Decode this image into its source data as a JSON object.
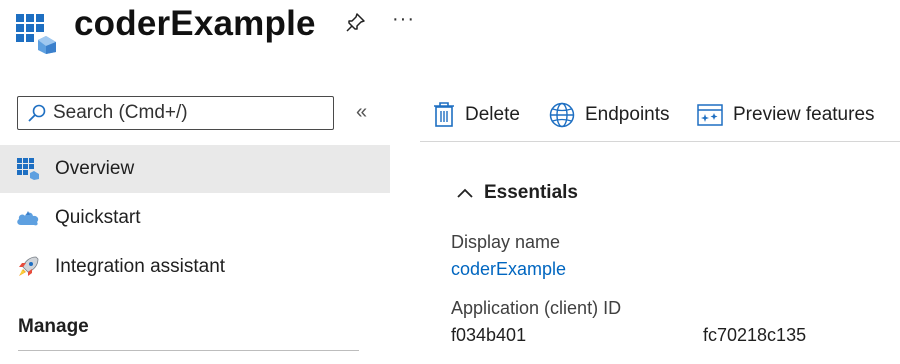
{
  "header": {
    "title": "coderExample",
    "pin_icon": "pin-icon",
    "more_label": "···"
  },
  "sidebar": {
    "search": {
      "placeholder": "Search (Cmd+/)",
      "value": ""
    },
    "collapse_label": "«",
    "items": [
      {
        "label": "Overview",
        "icon": "app-grid-icon",
        "active": true
      },
      {
        "label": "Quickstart",
        "icon": "cloud-icon",
        "active": false
      },
      {
        "label": "Integration assistant",
        "icon": "rocket-icon",
        "active": false
      }
    ],
    "section_manage": "Manage"
  },
  "toolbar": {
    "delete_label": "Delete",
    "endpoints_label": "Endpoints",
    "preview_label": "Preview features"
  },
  "essentials": {
    "title": "Essentials",
    "display_name_label": "Display name",
    "display_name_value": "coderExample",
    "client_id_label": "Application (client) ID",
    "client_id_value": "f034b401",
    "client_id_value_2": "fc70218c135"
  },
  "colors": {
    "accent": "#0066c0",
    "active_bg": "#e9e9e9",
    "icon_blue": "#1e6fc2"
  }
}
